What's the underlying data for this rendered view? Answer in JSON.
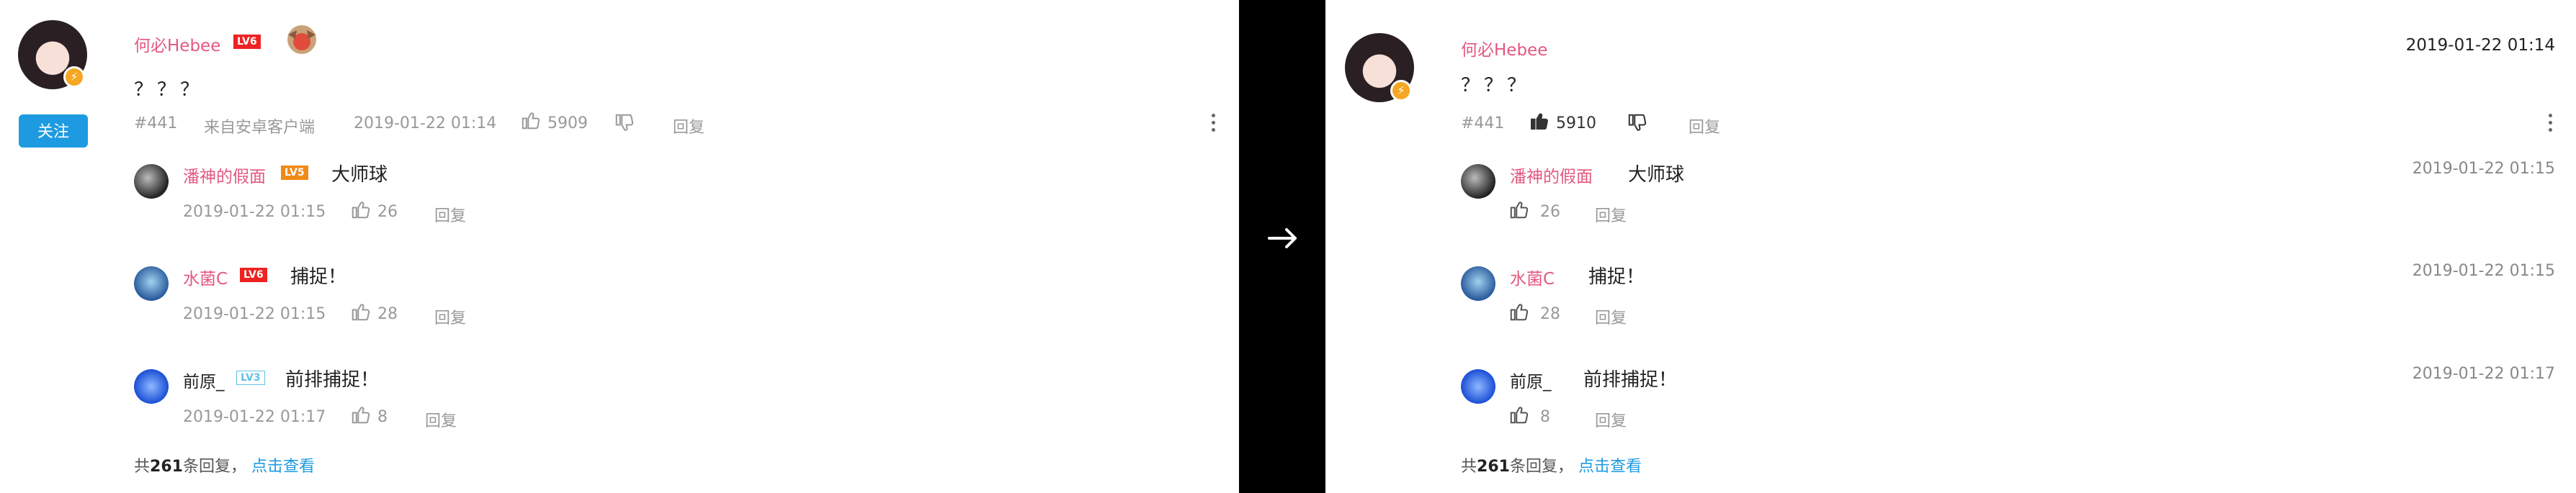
{
  "left": {
    "main": {
      "username": "何必Hebee",
      "level": "LV6",
      "content": "？？？",
      "floor": "#441",
      "source": "来自安卓客户端",
      "time": "2019-01-22 01:14",
      "likes": "5909",
      "reply_label": "回复",
      "follow_label": "关注"
    },
    "replies": [
      {
        "username": "潘神的假面",
        "level": "LV5",
        "content": "大师球",
        "time": "2019-01-22 01:15",
        "likes": "26",
        "reply_label": "回复"
      },
      {
        "username": "水菌C",
        "level": "LV6",
        "content": "捕捉！",
        "time": "2019-01-22 01:15",
        "likes": "28",
        "reply_label": "回复"
      },
      {
        "username": "前原_",
        "level": "LV3",
        "content": "前排捕捉！",
        "time": "2019-01-22 01:17",
        "likes": "8",
        "reply_label": "回复"
      }
    ],
    "summary": {
      "prefix": "共",
      "count": "261",
      "suffix": "条回复，",
      "link": "点击查看"
    }
  },
  "right": {
    "main": {
      "username": "何必Hebee",
      "content": "？？？",
      "floor": "#441",
      "time": "2019-01-22 01:14",
      "likes": "5910",
      "reply_label": "回复"
    },
    "replies": [
      {
        "username": "潘神的假面",
        "content": "大师球",
        "time": "2019-01-22 01:15",
        "likes": "26",
        "reply_label": "回复"
      },
      {
        "username": "水菌C",
        "content": "捕捉！",
        "time": "2019-01-22 01:15",
        "likes": "28",
        "reply_label": "回复"
      },
      {
        "username": "前原_",
        "content": "前排捕捉！",
        "time": "2019-01-22 01:17",
        "likes": "8",
        "reply_label": "回复"
      }
    ],
    "summary": {
      "prefix": "共",
      "count": "261",
      "suffix": "条回复，",
      "link": "点击查看"
    }
  },
  "icons": {
    "like": "thumbs-up-icon",
    "dislike": "thumbs-down-icon",
    "more": "more-vertical-icon",
    "arrow": "arrow-right-icon"
  },
  "colors": {
    "username": "#e4587f",
    "link": "#1e9be0",
    "level_red": "#e22",
    "level_orange": "#f08a16",
    "level_outline": "#63c1e8"
  }
}
